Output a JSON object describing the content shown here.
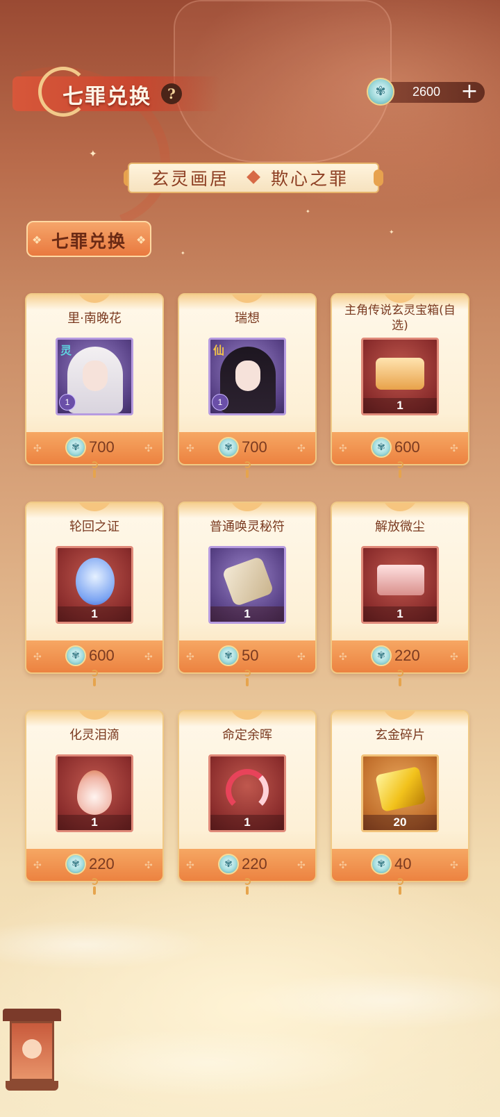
{
  "header": {
    "title": "七罪兑换",
    "help_icon": "?",
    "currency": {
      "icon": "spirit-coin-icon",
      "value": "2600",
      "add_label": "+"
    }
  },
  "category": {
    "left": "玄灵画居",
    "right": "欺心之罪"
  },
  "section": {
    "label": "七罪兑换"
  },
  "items": [
    {
      "name": "里·南晚花",
      "price": "700",
      "qty": "1",
      "tag": "灵"
    },
    {
      "name": "瑞想",
      "price": "700",
      "qty": "1",
      "tag": "仙"
    },
    {
      "name": "主角传说玄灵宝箱(自选)",
      "price": "600",
      "qty": "1"
    },
    {
      "name": "轮回之证",
      "price": "600",
      "qty": "1"
    },
    {
      "name": "普通唤灵秘符",
      "price": "50",
      "qty": "1"
    },
    {
      "name": "解放微尘",
      "price": "220",
      "qty": "1"
    },
    {
      "name": "化灵泪滴",
      "price": "220",
      "qty": "1"
    },
    {
      "name": "命定余晖",
      "price": "220",
      "qty": "1"
    },
    {
      "name": "玄金碎片",
      "price": "40",
      "qty": "20"
    }
  ],
  "colors": {
    "accent": "#ec8240",
    "title_red": "#c8472f",
    "text_brown": "#7a3a20"
  }
}
